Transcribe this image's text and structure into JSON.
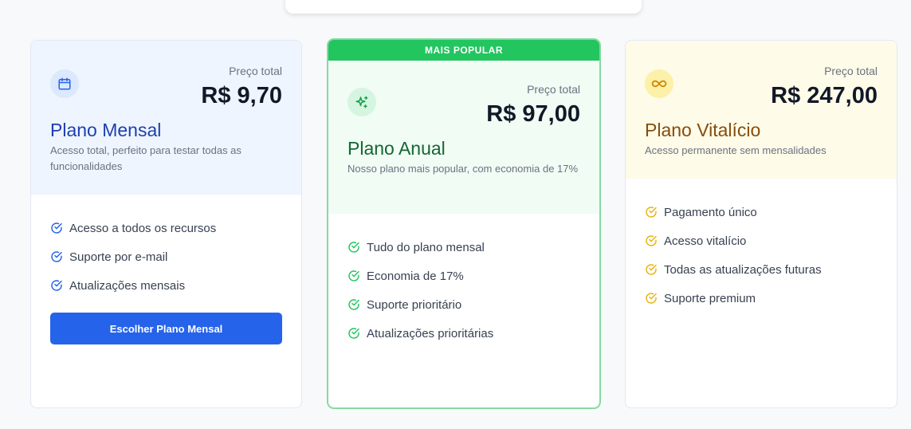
{
  "plans": [
    {
      "title": "Plano Mensal",
      "description": "Acesso total, perfeito para testar todas as funcionalidades",
      "price_label": "Preço total",
      "price": "R$ 9,70",
      "icon": "calendar-icon",
      "accent": "#2563eb",
      "features": [
        "Acesso a todos os recursos",
        "Suporte por e-mail",
        "Atualizações mensais"
      ],
      "button_label": "Escolher Plano Mensal"
    },
    {
      "badge": "MAIS POPULAR",
      "title": "Plano Anual",
      "description": "Nosso plano mais popular, com economia de 17%",
      "price_label": "Preço total",
      "price": "R$ 97,00",
      "icon": "sparkles-icon",
      "accent": "#22c55e",
      "features": [
        "Tudo do plano mensal",
        "Economia de 17%",
        "Suporte prioritário",
        "Atualizações prioritárias"
      ]
    },
    {
      "title": "Plano Vitalício",
      "description": "Acesso permanente sem mensalidades",
      "price_label": "Preço total",
      "price": "R$ 247,00",
      "icon": "infinity-icon",
      "accent": "#eab308",
      "features": [
        "Pagamento único",
        "Acesso vitalício",
        "Todas as atualizações futuras",
        "Suporte premium"
      ]
    }
  ]
}
